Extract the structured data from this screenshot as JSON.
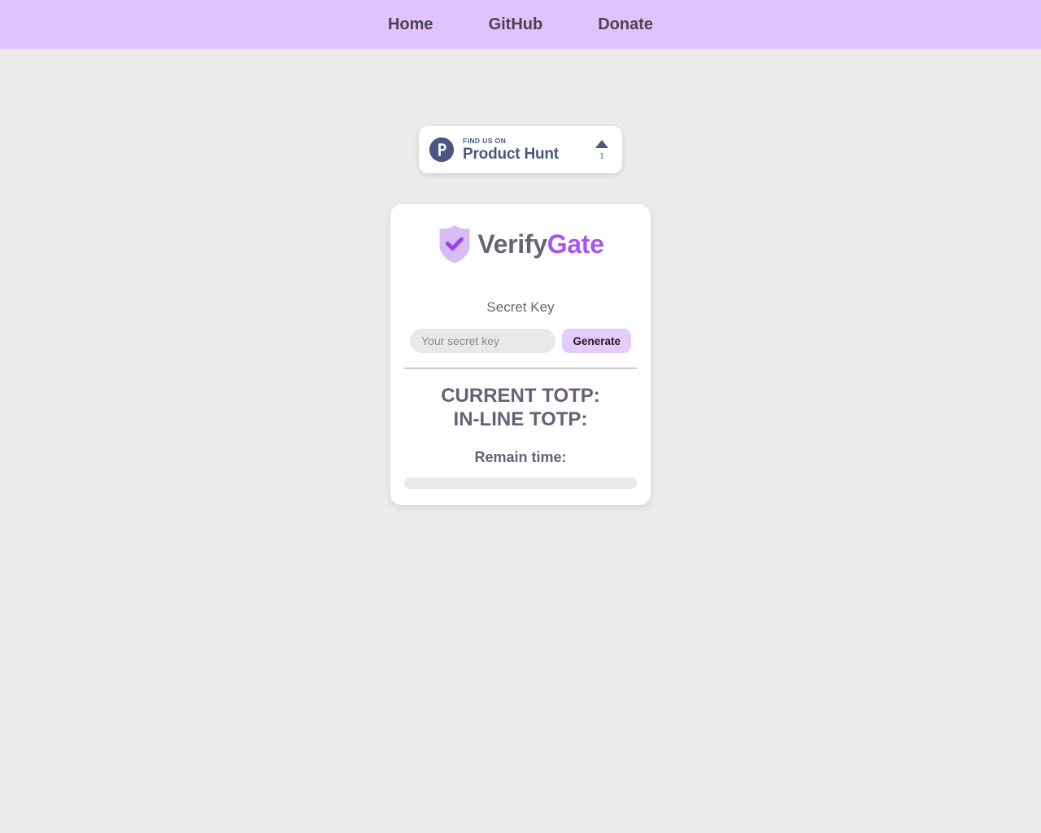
{
  "navbar": {
    "background_color": "#dfc3fb",
    "links": [
      {
        "label": "Home",
        "name": "nav-link-home"
      },
      {
        "label": "GitHub",
        "name": "nav-link-github"
      },
      {
        "label": "Donate",
        "name": "nav-link-donate"
      }
    ]
  },
  "product_hunt_badge": {
    "logo_icon": "product-hunt-logo-icon",
    "logo_letter": "P",
    "kicker": "FIND US ON",
    "name": "Product Hunt",
    "upvote_icon": "upvote-triangle-icon",
    "upvote_count": "1",
    "badge_color": "#4b5782"
  },
  "card": {
    "brand": {
      "shield_icon": "shield-check-icon",
      "text_primary": "Verify",
      "text_accent": "Gate",
      "primary_color": "#6b6277",
      "accent_color": "#a855f7",
      "shield_fill": "#d8bdf5",
      "shield_check": "#9747e8"
    },
    "secret_key": {
      "label": "Secret Key",
      "input_placeholder": "Your secret key",
      "input_value": "",
      "generate_label": "Generate",
      "generate_color": "#e4ccfa"
    },
    "results": {
      "current_totp_label": "CURRENT TOTP:",
      "current_totp_value": "",
      "inline_totp_label": "IN-LINE TOTP:",
      "inline_totp_value": "",
      "remain_time_label": "Remain time:",
      "remain_time_value": "",
      "progress_percent": 0,
      "progress_track_color": "#e8e8e8",
      "progress_fill_color": "#c9a4f2"
    }
  },
  "page": {
    "background_color": "#ebebeb"
  }
}
